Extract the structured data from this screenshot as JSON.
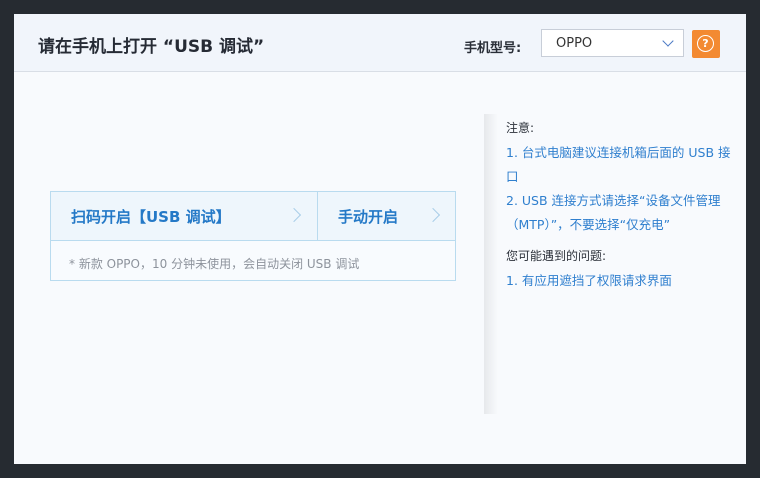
{
  "dialog": {
    "title": "请在手机上打开 “USB 调试”",
    "model_label": "手机型号:",
    "model_value": "OPPO",
    "help_glyph": "?"
  },
  "options": {
    "scan_label": "扫码开启【USB 调试】",
    "manual_label": "手动开启",
    "note": "* 新款 OPPO，10 分钟未使用，会自动关闭 USB 调试"
  },
  "notes": {
    "heading": "注意:",
    "items": [
      "1. 台式电脑建议连接机箱后面的 USB 接口",
      "2. USB 连接方式请选择“设备文件管理（MTP）”，不要选择“仅充电”"
    ],
    "problems_heading": "您可能遇到的问题:",
    "problems": [
      "1. 有应用遮挡了权限请求界面"
    ]
  },
  "colors": {
    "accent": "#2f7fce",
    "help": "#f38a32"
  },
  "icons": {
    "help": "question-circle-icon",
    "dropdown": "chevron-down-icon",
    "option": "chevron-right-icon"
  }
}
